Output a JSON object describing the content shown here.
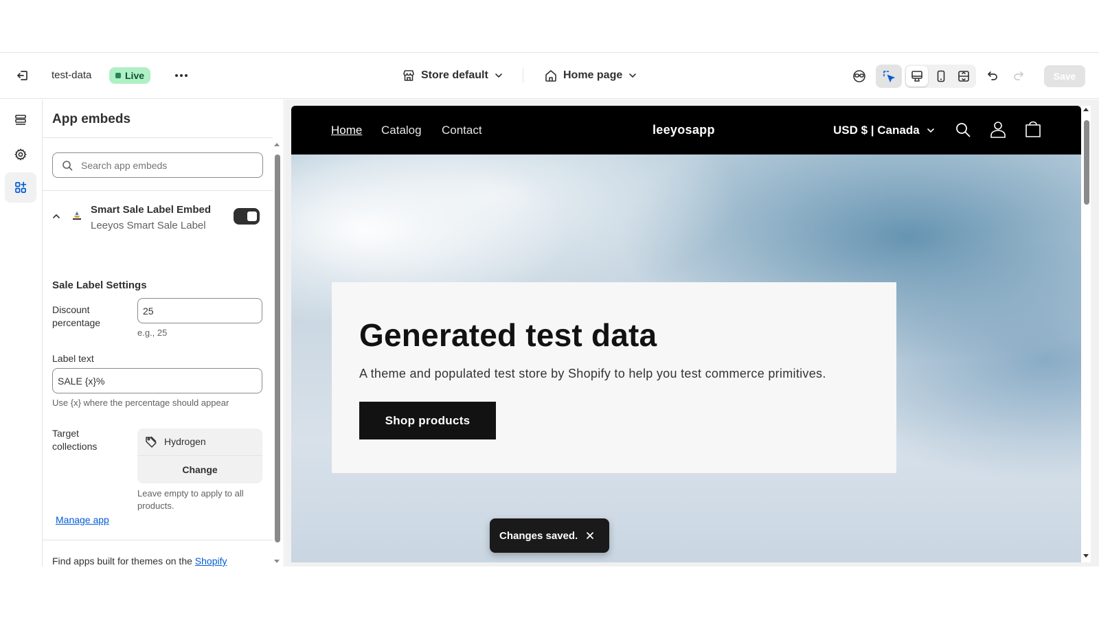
{
  "topbar": {
    "store_name": "test-data",
    "live_badge": "Live",
    "theme_picker": "Store default",
    "page_picker": "Home page",
    "save_label": "Save",
    "icons": [
      "exit-icon",
      "more-icon",
      "store-icon",
      "home-icon",
      "chevron-down-icon",
      "inspector-icon",
      "select-icon",
      "desktop-icon",
      "mobile-icon",
      "fullscreen-icon",
      "undo-icon",
      "redo-icon"
    ]
  },
  "rail": {
    "items": [
      {
        "name": "sections",
        "icon": "sections-icon"
      },
      {
        "name": "theme-settings",
        "icon": "gear-icon"
      },
      {
        "name": "app-embeds",
        "icon": "apps-icon",
        "active": true
      }
    ]
  },
  "panel": {
    "title": "App embeds",
    "search_placeholder": "Search app embeds",
    "embed": {
      "title": "Smart Sale Label Embed",
      "subtitle": "Leeyos Smart Sale Label",
      "enabled": true
    },
    "section_title": "Sale Label Settings",
    "discount": {
      "label": "Discount percentage",
      "value": "25",
      "help": "e.g., 25"
    },
    "label_text": {
      "label": "Label text",
      "value": "SALE {x}%",
      "help": "Use {x} where the percentage should appear"
    },
    "collections": {
      "label": "Target collections",
      "item": "Hydrogen",
      "change_label": "Change",
      "help": "Leave empty to apply to all products."
    },
    "manage_app": "Manage app",
    "footer_text": "Find apps built for themes on the ",
    "footer_link": "Shopify"
  },
  "store": {
    "nav": [
      "Home",
      "Catalog",
      "Contact"
    ],
    "brand": "leeyosapp",
    "currency": "USD $ | Canada",
    "hero_title": "Generated test data",
    "hero_sub": "A theme and populated test store by Shopify to help you test commerce primitives.",
    "hero_button": "Shop products"
  },
  "toast": {
    "text": "Changes saved."
  },
  "colors": {
    "live_badge_bg": "#aff0c4",
    "link": "#005bd3",
    "store_header": "#000000",
    "toast_bg": "#1a1a1a"
  }
}
